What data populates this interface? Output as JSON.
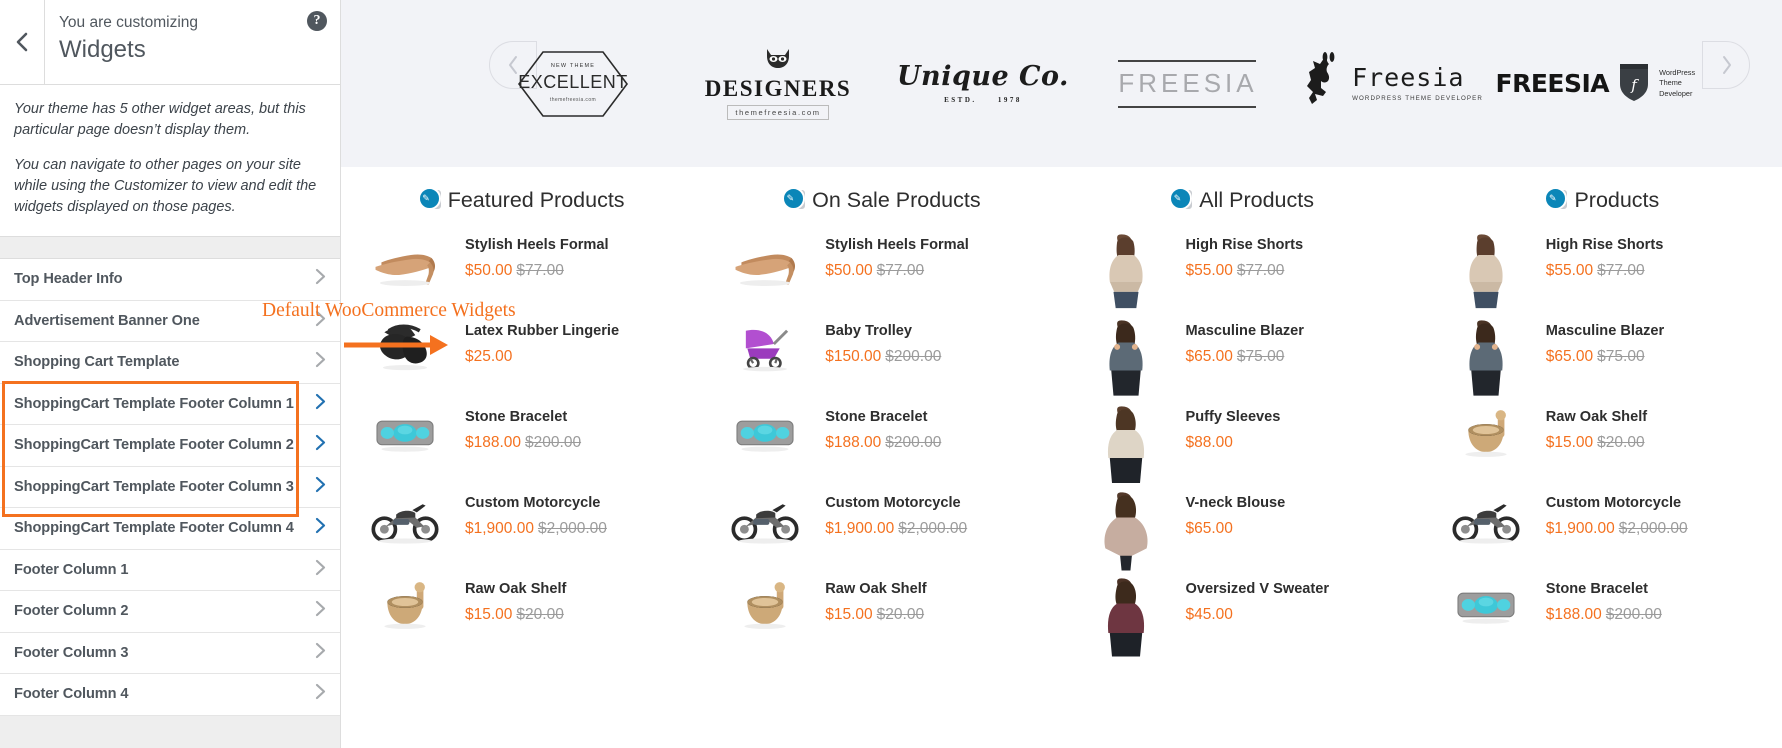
{
  "customizer": {
    "back_icon": "chevron-left-icon",
    "eyebrow": "You are customizing",
    "title": "Widgets",
    "help_icon": "?",
    "notice": [
      "Your theme has 5 other widget areas, but this particular page doesn’t display them.",
      "You can navigate to other pages on your site while using the Customizer to view and edit the widgets displayed on those pages."
    ],
    "items": [
      {
        "label": "Top Header Info",
        "highlighted": false
      },
      {
        "label": "Advertisement Banner One",
        "highlighted": false
      },
      {
        "label": "Shopping Cart Template",
        "highlighted": false
      },
      {
        "label": "ShoppingCart Template Footer Column 1",
        "highlighted": true
      },
      {
        "label": "ShoppingCart Template Footer Column 2",
        "highlighted": true
      },
      {
        "label": "ShoppingCart Template Footer Column 3",
        "highlighted": true
      },
      {
        "label": "ShoppingCart Template Footer Column 4",
        "highlighted": true
      },
      {
        "label": "Footer Column 1",
        "highlighted": false
      },
      {
        "label": "Footer Column 2",
        "highlighted": false
      },
      {
        "label": "Footer Column 3",
        "highlighted": false
      },
      {
        "label": "Footer Column 4",
        "highlighted": false
      }
    ],
    "annotation": {
      "label": "Default WooCommerce Widgets",
      "color": "#f4711f"
    }
  },
  "preview": {
    "carousel": {
      "prev_icon": "chevron-left-icon",
      "next_icon": "chevron-right-icon"
    },
    "logos": [
      {
        "type": "hexagon",
        "top": "NEW THEME",
        "main": "EXCELLENT",
        "bottom": "themefreesia.com"
      },
      {
        "type": "designers",
        "icon": "raccoon-icon",
        "main": "DESIGNERS",
        "bottom": "themefreesia.com"
      },
      {
        "type": "script",
        "main": "Unique Co.",
        "bottom_left": "ESTD.",
        "bottom_right": "1978"
      },
      {
        "type": "lines",
        "main": "FREESIA"
      },
      {
        "type": "lion",
        "icon": "lion-icon",
        "main": "Freesia",
        "sub": "WORDPRESS THEME DEVELOPER"
      },
      {
        "type": "shield",
        "main": "FREESIA",
        "icon": "shield-icon",
        "sub_line1": "WordPress",
        "sub_line2": "Theme Developer"
      }
    ],
    "widgets": [
      {
        "title": "Featured Products",
        "edit_icon": "edit-shortcut-icon",
        "products": [
          {
            "image": "heels-image",
            "name": "Stylish Heels Formal",
            "price": "$50.00",
            "old_price": "$77.00"
          },
          {
            "image": "lingerie-image",
            "name": "Latex Rubber Lingerie",
            "price": "$25.00",
            "old_price": ""
          },
          {
            "image": "bracelet-image",
            "name": "Stone Bracelet",
            "price": "$188.00",
            "old_price": "$200.00"
          },
          {
            "image": "motorcycle-image",
            "name": "Custom Motorcycle",
            "price": "$1,900.00",
            "old_price": "$2,000.00"
          },
          {
            "image": "mortar-image",
            "name": "Raw Oak Shelf",
            "price": "$15.00",
            "old_price": "$20.00"
          }
        ]
      },
      {
        "title": "On Sale Products",
        "edit_icon": "edit-shortcut-icon",
        "products": [
          {
            "image": "heels-image",
            "name": "Stylish Heels Formal",
            "price": "$50.00",
            "old_price": "$77.00"
          },
          {
            "image": "stroller-image",
            "name": "Baby Trolley",
            "price": "$150.00",
            "old_price": "$200.00"
          },
          {
            "image": "bracelet-image",
            "name": "Stone Bracelet",
            "price": "$188.00",
            "old_price": "$200.00"
          },
          {
            "image": "motorcycle-image",
            "name": "Custom Motorcycle",
            "price": "$1,900.00",
            "old_price": "$2,000.00"
          },
          {
            "image": "mortar-image",
            "name": "Raw Oak Shelf",
            "price": "$15.00",
            "old_price": "$20.00"
          }
        ]
      },
      {
        "title": "All Products",
        "edit_icon": "edit-shortcut-icon",
        "products": [
          {
            "image": "model-beige-image",
            "name": "High Rise Shorts",
            "price": "$55.00",
            "old_price": "$77.00"
          },
          {
            "image": "model-gray-image",
            "name": "Masculine Blazer",
            "price": "$65.00",
            "old_price": "$75.00"
          },
          {
            "image": "model-cream-image",
            "name": "Puffy Sleeves",
            "price": "$88.00",
            "old_price": ""
          },
          {
            "image": "model-blouse-image",
            "name": "V-neck Blouse",
            "price": "$65.00",
            "old_price": ""
          },
          {
            "image": "model-maroon-image",
            "name": "Oversized V Sweater",
            "price": "$45.00",
            "old_price": ""
          }
        ]
      },
      {
        "title": "Products",
        "edit_icon": "edit-shortcut-icon",
        "products": [
          {
            "image": "model-beige-image",
            "name": "High Rise Shorts",
            "price": "$55.00",
            "old_price": "$77.00"
          },
          {
            "image": "model-gray-image",
            "name": "Masculine Blazer",
            "price": "$65.00",
            "old_price": "$75.00"
          },
          {
            "image": "mortar-image",
            "name": "Raw Oak Shelf",
            "price": "$15.00",
            "old_price": "$20.00"
          },
          {
            "image": "motorcycle-image",
            "name": "Custom Motorcycle",
            "price": "$1,900.00",
            "old_price": "$2,000.00"
          },
          {
            "image": "bracelet-image",
            "name": "Stone Bracelet",
            "price": "$188.00",
            "old_price": "$200.00"
          }
        ]
      }
    ]
  }
}
